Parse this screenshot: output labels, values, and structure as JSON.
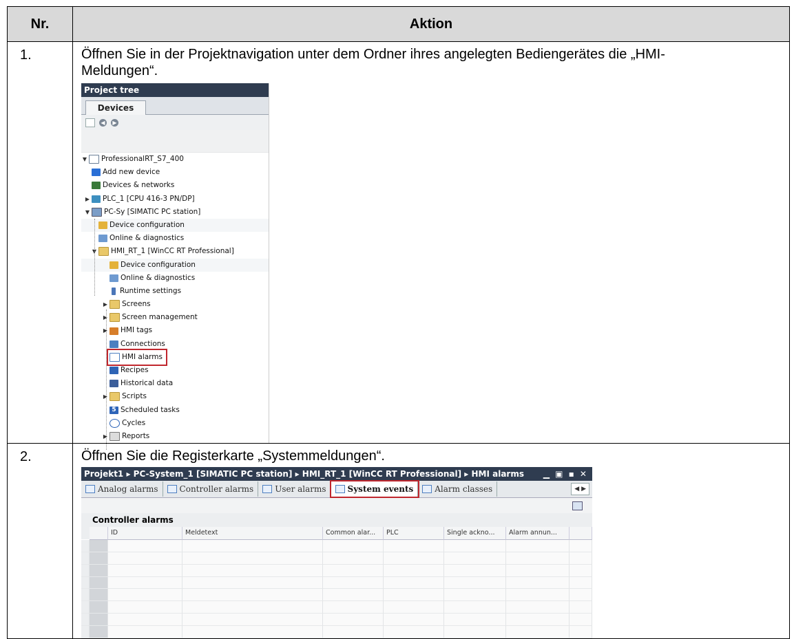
{
  "table": {
    "header_nr": "Nr.",
    "header_action": "Aktion",
    "steps": [
      {
        "nr": "1.",
        "text_line1": "Öffnen Sie in der Projektnavigation unter dem Ordner ihres angelegten Bediengerätes die „HMI-",
        "text_line2": "Meldungen“."
      },
      {
        "nr": "2.",
        "text_line1": "Öffnen Sie die Registerkarte „Systemmeldungen“."
      }
    ]
  },
  "project_tree": {
    "title": "Project tree",
    "tab": "Devices",
    "items": [
      {
        "label": "ProfessionalRT_S7_400",
        "icon": "project-icon"
      },
      {
        "label": "Add new device",
        "icon": "add-device-icon"
      },
      {
        "label": "Devices & networks",
        "icon": "network-icon"
      },
      {
        "label": "PLC_1 [CPU 416-3 PN/DP]",
        "icon": "plc-icon"
      },
      {
        "label": "PC-Sy [SIMATIC PC station]",
        "icon": "pc-station-icon"
      },
      {
        "label": "Device configuration",
        "icon": "device-config-icon"
      },
      {
        "label": "Online & diagnostics",
        "icon": "diagnostics-icon"
      },
      {
        "label": "HMI_RT_1 [WinCC RT Professional]",
        "icon": "hmi-folder-icon"
      },
      {
        "label": "Device configuration",
        "icon": "device-config-icon"
      },
      {
        "label": "Online & diagnostics",
        "icon": "diagnostics-icon"
      },
      {
        "label": "Runtime settings",
        "icon": "runtime-settings-icon"
      },
      {
        "label": "Screens",
        "icon": "folder-icon"
      },
      {
        "label": "Screen management",
        "icon": "screen-management-icon"
      },
      {
        "label": "HMI tags",
        "icon": "hmi-tags-icon"
      },
      {
        "label": "Connections",
        "icon": "connections-icon"
      },
      {
        "label": "HMI alarms",
        "icon": "alarms-icon"
      },
      {
        "label": "Recipes",
        "icon": "recipes-icon"
      },
      {
        "label": "Historical data",
        "icon": "historical-data-icon"
      },
      {
        "label": "Scripts",
        "icon": "scripts-icon"
      },
      {
        "label": "Scheduled tasks",
        "icon": "scheduled-tasks-icon"
      },
      {
        "label": "Cycles",
        "icon": "cycles-icon"
      },
      {
        "label": "Reports",
        "icon": "reports-icon"
      }
    ],
    "scheduled_icon_glyph": "5"
  },
  "editor": {
    "breadcrumb": "Projekt1 ▸ PC-System_1 [SIMATIC PC station] ▸ HMI_RT_1 [WinCC RT Professional] ▸ HMI alarms",
    "tabs": [
      "Analog alarms",
      "Controller alarms",
      "User alarms",
      "System events",
      "Alarm classes"
    ],
    "selected_tab": "System events",
    "section_title": "Controller alarms",
    "columns": [
      "",
      "ID",
      "Meldetext",
      "Common alar...",
      "PLC",
      "Single ackno...",
      "Alarm annun...",
      ""
    ]
  }
}
